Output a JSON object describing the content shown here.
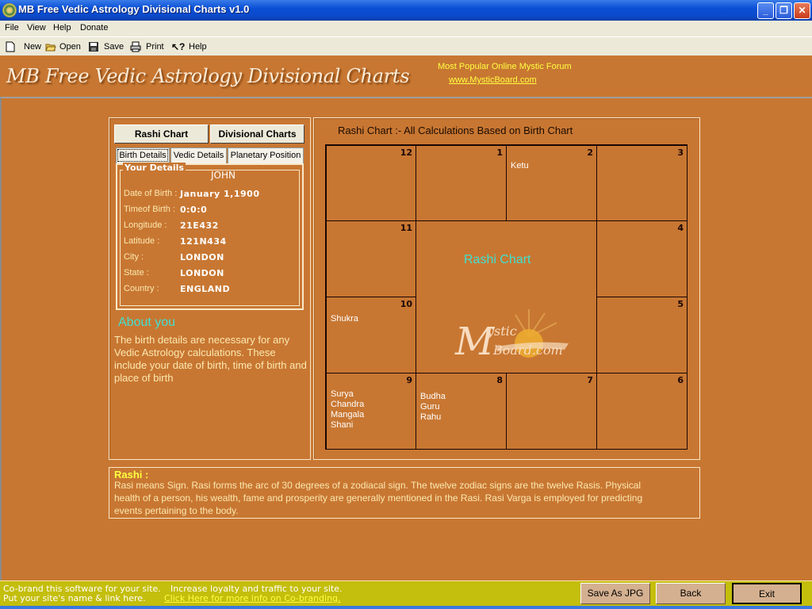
{
  "window": {
    "title": "MB Free Vedic Astrology Divisional Charts v1.0",
    "controls": {
      "minimize": "minimize-icon",
      "restore": "restore-icon",
      "close": "close-icon"
    }
  },
  "menu": [
    "File",
    "View",
    "Help",
    "Donate"
  ],
  "toolbar": [
    {
      "label": "New",
      "icon": "new-document-icon"
    },
    {
      "label": "Open",
      "icon": "open-folder-icon"
    },
    {
      "label": "Save",
      "icon": "floppy-disk-icon"
    },
    {
      "label": "Print",
      "icon": "printer-icon"
    },
    {
      "label": "Help",
      "icon": "context-help-icon"
    }
  ],
  "banner": {
    "logo_text": "MB Free Vedic Astrology Divisional Charts",
    "forum_text": "Most Popular Online Mystic Forum",
    "forum_link": "www.MysticBoard.com"
  },
  "left_panel": {
    "buttons": {
      "rashi": "Rashi Chart",
      "divisional": "Divisional Charts"
    },
    "tabs": [
      "Birth Details",
      "Vedic Details",
      "Planetary Position"
    ],
    "active_tab": "Birth Details",
    "details": {
      "legend": "Your Details",
      "name": "JOHN",
      "fields": [
        {
          "label": "Date of Birth :",
          "value": "January 1,1900"
        },
        {
          "label": "Timeof Birth :",
          "value": "0:0:0"
        },
        {
          "label": "Longitude :",
          "value": "21E432"
        },
        {
          "label": "Latitude  :",
          "value": "121N434"
        },
        {
          "label": "City :",
          "value": "LONDON"
        },
        {
          "label": "State :",
          "value": "LONDON"
        },
        {
          "label": "Country :",
          "value": "ENGLAND"
        }
      ]
    },
    "about": {
      "title": "About you",
      "text": "The birth details are necessary for any Vedic Astrology calculations. These include your date of birth, time of birth and place of birth"
    }
  },
  "chart_panel": {
    "title": "Rashi Chart :- All Calculations Based on Birth Chart",
    "center_label": "Rashi Chart",
    "watermark": "MysticBoard.com",
    "houses": [
      {
        "num": "12",
        "planets": []
      },
      {
        "num": "1",
        "planets": []
      },
      {
        "num": "2",
        "planets": [
          "Ketu"
        ]
      },
      {
        "num": "3",
        "planets": []
      },
      {
        "num": "11",
        "planets": []
      },
      {
        "num": "4",
        "planets": []
      },
      {
        "num": "10",
        "planets": [
          "Shukra"
        ]
      },
      {
        "num": "5",
        "planets": []
      },
      {
        "num": "9",
        "planets": [
          "Surya",
          "Chandra",
          "Mangala",
          "Shani"
        ]
      },
      {
        "num": "8",
        "planets": [
          "Budha",
          "Guru",
          "Rahu"
        ]
      },
      {
        "num": "7",
        "planets": []
      },
      {
        "num": "6",
        "planets": []
      }
    ]
  },
  "info": {
    "title": "Rashi :",
    "text": "Rasi means Sign. Rasi forms the arc of 30 degrees of a zodiacal sign. The twelve zodiac signs are the twelve Rasis. Physical health of a person, his wealth, fame and prosperity are generally mentioned in the Rasi. Rasi Varga is employed for predicting events pertaining to the body."
  },
  "footer": {
    "cobrand_line1": "Co-brand this software for your site.",
    "cobrand_more": "Increase loyalty and traffic to your site.",
    "cobrand_line2": "Put your site's name & link here.",
    "cobrand_link": "Click Here for more info on Co-branding.",
    "buttons": {
      "save_jpg": "Save As JPG",
      "back": "Back",
      "exit": "Exit"
    }
  },
  "colors": {
    "background": "#c87732",
    "accent_cyan": "#40e0d0",
    "accent_yellow": "#ffff40",
    "footer_bg": "#c4be0c"
  }
}
